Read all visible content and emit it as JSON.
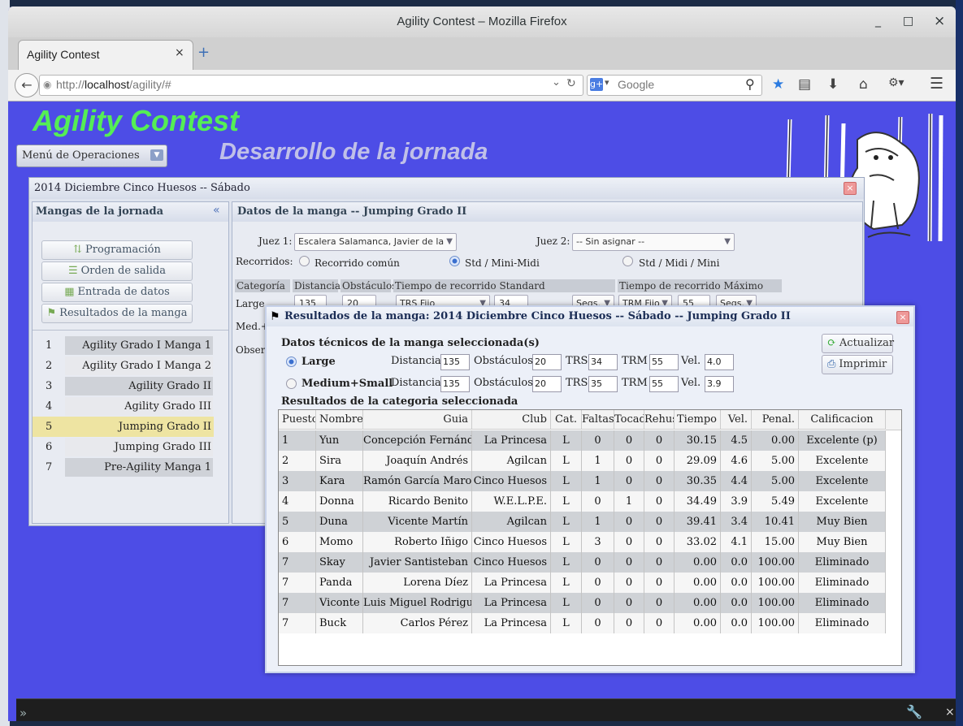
{
  "window": {
    "title": "Agility Contest – Mozilla Firefox",
    "minimize": "_",
    "maximize": "□",
    "close": "×"
  },
  "tab": {
    "label": "Agility Contest",
    "close": "×",
    "new": "+"
  },
  "urlbar": {
    "prefix": "http://",
    "host": "localhost",
    "path": "/agility/#",
    "reload": "↻",
    "dropdown": "⌄"
  },
  "search": {
    "placeholder": "Google",
    "engine_glyph": "g+"
  },
  "page": {
    "title": "Agility Contest",
    "subtitle": "Desarrollo de la jornada",
    "menu_button": "Menú de Operaciones"
  },
  "main": {
    "title": "2014 Diciembre Cinco Huesos -- Sábado",
    "left": {
      "title": "Mangas de la jornada",
      "buttons": [
        {
          "label": "Programación",
          "icon": "⇅"
        },
        {
          "label": "Orden de salida",
          "icon": "☰"
        },
        {
          "label": "Entrada de datos",
          "icon": "▦"
        },
        {
          "label": "Resultados de la manga",
          "icon": "⚑"
        }
      ],
      "rounds": [
        {
          "num": "1",
          "label": "Agility Grado I Manga 1"
        },
        {
          "num": "2",
          "label": "Agility Grado I Manga 2"
        },
        {
          "num": "3",
          "label": "Agility Grado II"
        },
        {
          "num": "4",
          "label": "Agility Grado III"
        },
        {
          "num": "5",
          "label": "Jumping Grado II",
          "selected": true
        },
        {
          "num": "6",
          "label": "Jumping Grado III"
        },
        {
          "num": "7",
          "label": "Pre-Agility Manga 1"
        }
      ]
    },
    "right": {
      "title": "Datos de la manga -- Jumping Grado II",
      "juez1_label": "Juez 1:",
      "juez1_value": "Escalera Salamanca, Javier de la",
      "juez2_label": "Juez 2:",
      "juez2_value": "-- Sin asignar --",
      "recorridos_label": "Recorridos:",
      "recorridos": [
        "Recorrido común",
        "Std / Mini-Midi",
        "Std / Midi / Mini"
      ],
      "headers": [
        "Categoría",
        "Distancia",
        "Obstáculos",
        "Tiempo de recorrido Standard",
        "Tiempo de recorrido Máximo"
      ],
      "large_label": "Large",
      "large_dist": "135",
      "large_obst": "20",
      "trs_mode": "TRS Fijo",
      "trs_value": "34",
      "trs_unit": "Segs.",
      "trm_mode": "TRM Fijo",
      "trm_value": "55",
      "trm_unit": "Segs.",
      "medium_label": "Med.+",
      "obs_label": "Observ"
    }
  },
  "results": {
    "title": "Resultados de la manga: 2014 Diciembre Cinco Huesos -- Sábado -- Jumping Grado II",
    "tech_title": "Datos técnicos de la manga seleccionada(s)",
    "refresh_label": "Actualizar",
    "print_label": "Imprimir",
    "categories": [
      {
        "name": "Large",
        "dist": "135",
        "obst": "20",
        "trs": "34",
        "trm": "55",
        "vel": "4.0",
        "selected": true
      },
      {
        "name": "Medium+Small",
        "dist": "135",
        "obst": "20",
        "trs": "35",
        "trm": "55",
        "vel": "3.9",
        "selected": false
      }
    ],
    "labels": {
      "dist": "Distancia",
      "obst": "Obstáculos",
      "trs": "TRS",
      "trm": "TRM",
      "vel": "Vel."
    },
    "category_title": "Resultados de la categoria seleccionada",
    "columns": [
      "Puesto",
      "Nombre",
      "Guia",
      "Club",
      "Cat.",
      "Faltas",
      "Tocados",
      "Rehuses",
      "Tiempo",
      "Vel.",
      "Penal.",
      "Calificacion"
    ],
    "rows": [
      [
        "1",
        "Yun",
        "Concepción Fernández",
        "La Princesa",
        "L",
        "0",
        "0",
        "0",
        "30.15",
        "4.5",
        "0.00",
        "Excelente (p)"
      ],
      [
        "2",
        "Sira",
        "Joaquín Andrés",
        "Agilcan",
        "L",
        "1",
        "0",
        "0",
        "29.09",
        "4.6",
        "5.00",
        "Excelente"
      ],
      [
        "3",
        "Kara",
        "Ramón García Marot",
        "Cinco Huesos",
        "L",
        "1",
        "0",
        "0",
        "30.35",
        "4.4",
        "5.00",
        "Excelente"
      ],
      [
        "4",
        "Donna",
        "Ricardo Benito",
        "W.E.L.P.E.",
        "L",
        "0",
        "1",
        "0",
        "34.49",
        "3.9",
        "5.49",
        "Excelente"
      ],
      [
        "5",
        "Duna",
        "Vicente Martín",
        "Agilcan",
        "L",
        "1",
        "0",
        "0",
        "39.41",
        "3.4",
        "10.41",
        "Muy Bien"
      ],
      [
        "6",
        "Momo",
        "Roberto Iñigo",
        "Cinco Huesos",
        "L",
        "3",
        "0",
        "0",
        "33.02",
        "4.1",
        "15.00",
        "Muy Bien"
      ],
      [
        "7",
        "Skay",
        "Javier Santisteban",
        "Cinco Huesos",
        "L",
        "0",
        "0",
        "0",
        "0.00",
        "0.0",
        "100.00",
        "Eliminado"
      ],
      [
        "7",
        "Panda",
        "Lorena Díez",
        "La Princesa",
        "L",
        "0",
        "0",
        "0",
        "0.00",
        "0.0",
        "100.00",
        "Eliminado"
      ],
      [
        "7",
        "Viconte",
        "Luis Miguel Rodriguez",
        "La Princesa",
        "L",
        "0",
        "0",
        "0",
        "0.00",
        "0.0",
        "100.00",
        "Eliminado"
      ],
      [
        "7",
        "Buck",
        "Carlos Pérez",
        "La Princesa",
        "L",
        "0",
        "0",
        "0",
        "0.00",
        "0.0",
        "100.00",
        "Eliminado"
      ]
    ]
  },
  "colors": {
    "page_bg": "#4d4de6",
    "title_green": "#55ee55",
    "selected_row": "#eee4a2"
  },
  "icons": [
    "back-icon",
    "reload-icon",
    "search-icon",
    "bookmark-star-icon",
    "reading-list-icon",
    "download-icon",
    "home-icon",
    "addons-icon",
    "hamburger-menu-icon",
    "wrench-icon"
  ]
}
